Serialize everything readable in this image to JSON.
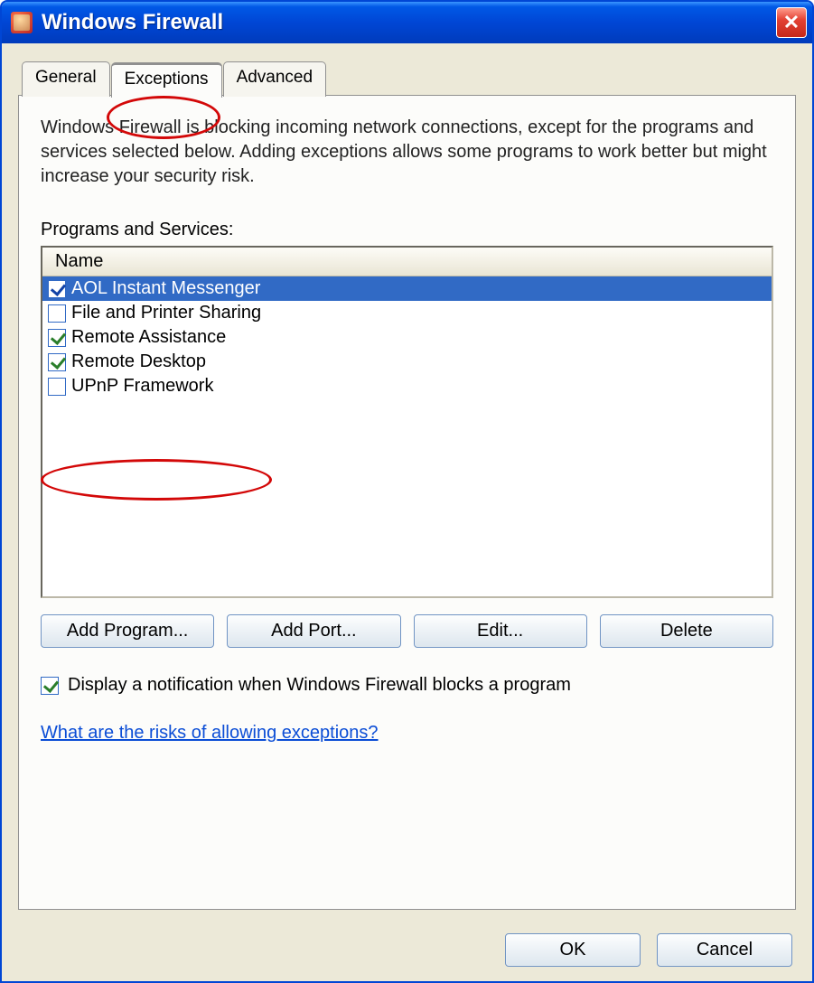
{
  "titlebar": {
    "title": "Windows Firewall",
    "close_icon": "✕"
  },
  "tabs": [
    "General",
    "Exceptions",
    "Advanced"
  ],
  "active_tab_index": 1,
  "intro": "Windows Firewall is blocking incoming network connections, except for the programs and services selected below. Adding exceptions allows some programs to work better but might increase your security risk.",
  "list_label": "Programs and Services:",
  "list_header": "Name",
  "items": [
    {
      "label": "AOL Instant Messenger",
      "checked": true,
      "selected": true
    },
    {
      "label": "File and Printer Sharing",
      "checked": false,
      "selected": false
    },
    {
      "label": "Remote Assistance",
      "checked": true,
      "selected": false
    },
    {
      "label": "Remote Desktop",
      "checked": true,
      "selected": false
    },
    {
      "label": "UPnP Framework",
      "checked": false,
      "selected": false
    }
  ],
  "buttons": {
    "add_program": "Add Program...",
    "add_port": "Add Port...",
    "edit": "Edit...",
    "delete": "Delete"
  },
  "notify": {
    "checked": true,
    "label": "Display a notification when Windows Firewall blocks a program"
  },
  "help_link": "What are the risks of allowing exceptions?",
  "footer": {
    "ok": "OK",
    "cancel": "Cancel"
  }
}
